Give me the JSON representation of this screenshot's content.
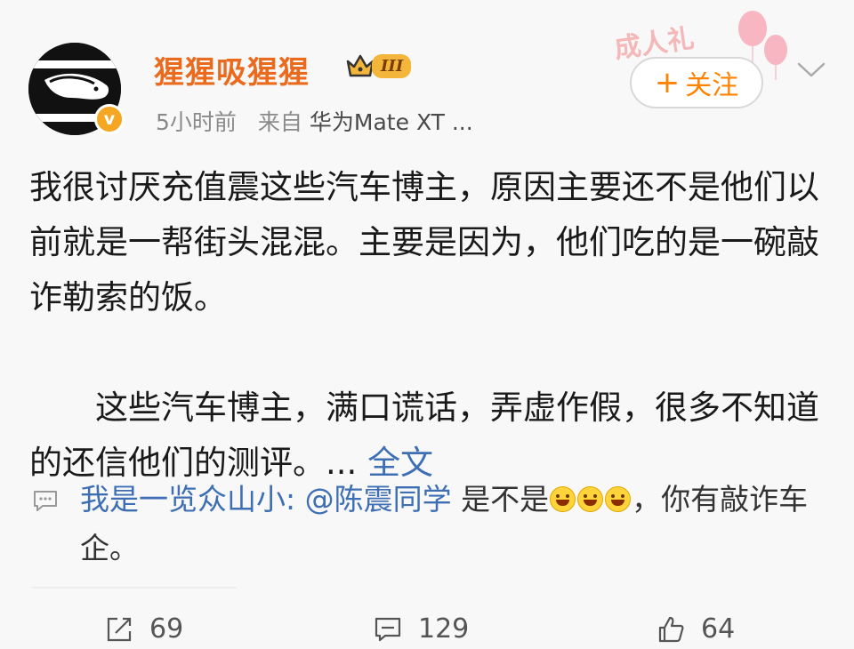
{
  "post": {
    "author_name": "猩猩吸猩猩",
    "rank_badge": "III",
    "verified_mark": "v",
    "time": "5小时前",
    "source_label": "来自",
    "source_device": "华为Mate XT ...",
    "follow_label": "关注",
    "follow_plus": "+",
    "decor_text": "成人礼",
    "body_p1": "我很讨厌充值震这些汽车博主，原因主要还不是他们以前就是一帮街头混混。主要是因为，他们吃的是一碗敲诈勒索的饭。",
    "body_p2": "这些汽车博主，满口谎话，弄虚作假，很多不知道的还信他们的测评。",
    "ellipsis": "...",
    "more_label": "全文"
  },
  "comment": {
    "commenter": "我是一览众山小:",
    "mention": "@陈震同学",
    "text_before_emoji": " 是不是",
    "emoji_count": 3,
    "text_after_emoji": "，你有敲诈车企。"
  },
  "actions": {
    "repost_count": "69",
    "comment_count": "129",
    "like_count": "64"
  },
  "colors": {
    "name": "#eb6b1e",
    "link": "#3e6fb4",
    "follow": "#ff8200",
    "meta": "#8a8a8a"
  },
  "icons": {
    "verified": "verified-badge-icon",
    "rank": "crown-icon",
    "dropdown": "chevron-down-icon",
    "comment_hint": "comment-bubble-icon",
    "repost": "repost-icon",
    "comment": "comment-icon",
    "like": "like-icon"
  }
}
